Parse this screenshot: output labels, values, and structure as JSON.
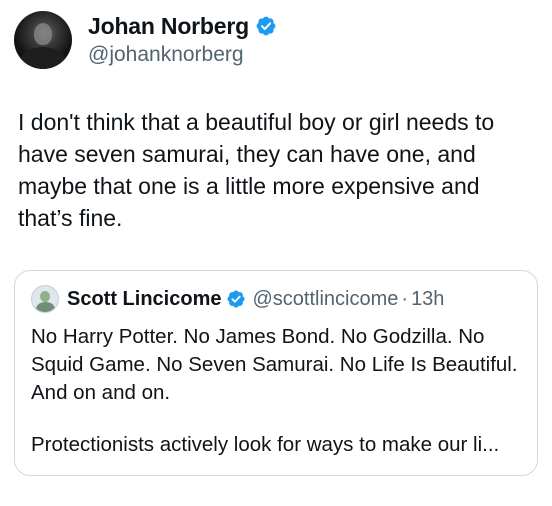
{
  "tweet": {
    "author": {
      "display_name": "Johan Norberg",
      "handle": "@johanknorberg",
      "verified_icon": "verified-badge-icon"
    },
    "text": "I don't think that a beautiful boy or girl needs to have seven samurai, they can have one, and maybe that one is a little more expensive and that’s fine."
  },
  "quoted_tweet": {
    "author": {
      "display_name": "Scott Lincicome",
      "handle": "@scottlincicome",
      "verified_icon": "verified-badge-icon"
    },
    "separator": "·",
    "timestamp": "13h",
    "text_paragraph_1": "No Harry Potter. No James Bond. No Godzilla. No Squid Game. No Seven Samurai. No Life Is Beautiful. And on and on.",
    "text_paragraph_2": "Protectionists actively look for ways to make our li..."
  },
  "colors": {
    "text_primary": "#0f1419",
    "text_secondary": "#536471",
    "verified_blue": "#1d9bf0",
    "border": "#cfd9de"
  }
}
